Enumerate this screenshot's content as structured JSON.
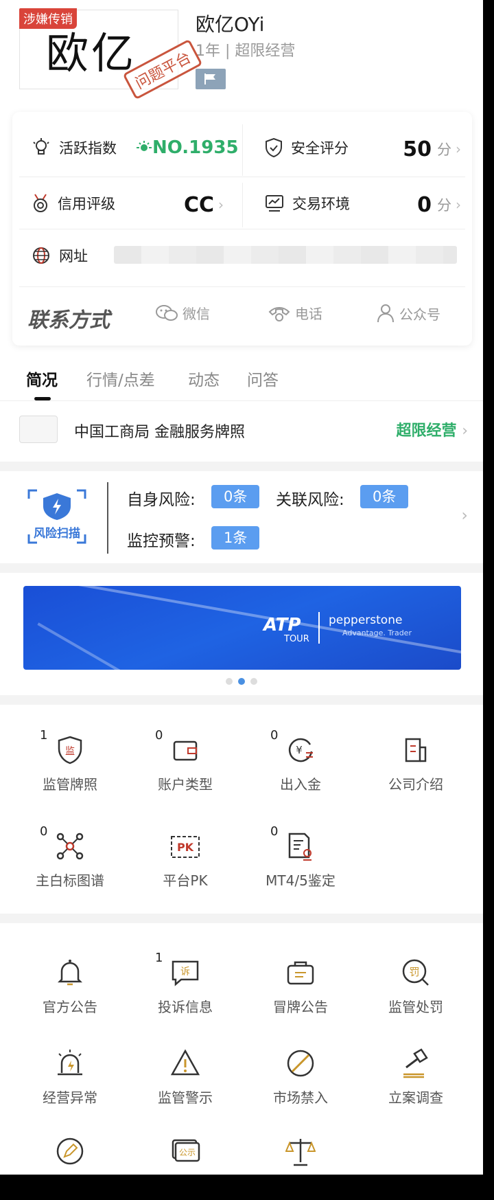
{
  "header": {
    "logo_text": "欧亿",
    "risk_tag": "涉嫌传销",
    "stamp": "问题平台",
    "name": "欧亿OYi",
    "subtitle": "1年 | 超限经营"
  },
  "stats": {
    "activity_label": "活跃指数",
    "activity_value": "NO.1935",
    "safety_label": "安全评分",
    "safety_value": "50",
    "safety_unit": "分",
    "credit_label": "信用评级",
    "credit_value": "CC",
    "env_label": "交易环境",
    "env_value": "0",
    "env_unit": "分",
    "url_label": "网址"
  },
  "contact": {
    "title": "联系方式",
    "wechat": "微信",
    "phone": "电话",
    "official": "公众号"
  },
  "tabs": [
    {
      "label": "简况"
    },
    {
      "label": "行情/点差"
    },
    {
      "label": "动态"
    },
    {
      "label": "问答"
    }
  ],
  "license": {
    "text": "中国工商局  金融服务牌照",
    "status": "超限经营"
  },
  "risk_scan": {
    "logo_label": "风险扫描",
    "self_label": "自身风险:",
    "self_value": "0条",
    "related_label": "关联风险:",
    "related_value": "0条",
    "monitor_label": "监控预警:",
    "monitor_value": "1条"
  },
  "banner": {
    "atp": "ATP",
    "tour": "TOUR",
    "brand": "pepperstone",
    "tagline": "Advantage. Trader"
  },
  "grid1": [
    {
      "label": "监管牌照",
      "count": "1",
      "icon": "shield-license-icon"
    },
    {
      "label": "账户类型",
      "count": "0",
      "icon": "wallet-icon"
    },
    {
      "label": "出入金",
      "count": "0",
      "icon": "yuan-exchange-icon"
    },
    {
      "label": "公司介绍",
      "count": "",
      "icon": "building-icon"
    },
    {
      "label": "主白标图谱",
      "count": "0",
      "icon": "network-graph-icon"
    },
    {
      "label": "平台PK",
      "count": "",
      "icon": "pk-icon"
    },
    {
      "label": "MT4/5鉴定",
      "count": "0",
      "icon": "certificate-icon"
    }
  ],
  "grid2": [
    {
      "label": "官方公告",
      "count": "",
      "icon": "bell-icon"
    },
    {
      "label": "投诉信息",
      "count": "1",
      "icon": "complaint-icon"
    },
    {
      "label": "冒牌公告",
      "count": "",
      "icon": "fake-notice-icon"
    },
    {
      "label": "监管处罚",
      "count": "",
      "icon": "penalty-icon"
    },
    {
      "label": "经营异常",
      "count": "",
      "icon": "alarm-icon"
    },
    {
      "label": "监管警示",
      "count": "",
      "icon": "warning-icon"
    },
    {
      "label": "市场禁入",
      "count": "",
      "icon": "ban-icon"
    },
    {
      "label": "立案调查",
      "count": "",
      "icon": "gavel-icon"
    },
    {
      "label": "",
      "count": "",
      "icon": "edit-icon"
    },
    {
      "label": "",
      "count": "",
      "icon": "public-notice-icon"
    },
    {
      "label": "",
      "count": "",
      "icon": "scale-icon"
    }
  ],
  "colors": {
    "green": "#2fae6a",
    "blue_pill": "#5b9df0",
    "red_tag": "#d9443a",
    "gold_icon": "#c9962b"
  }
}
